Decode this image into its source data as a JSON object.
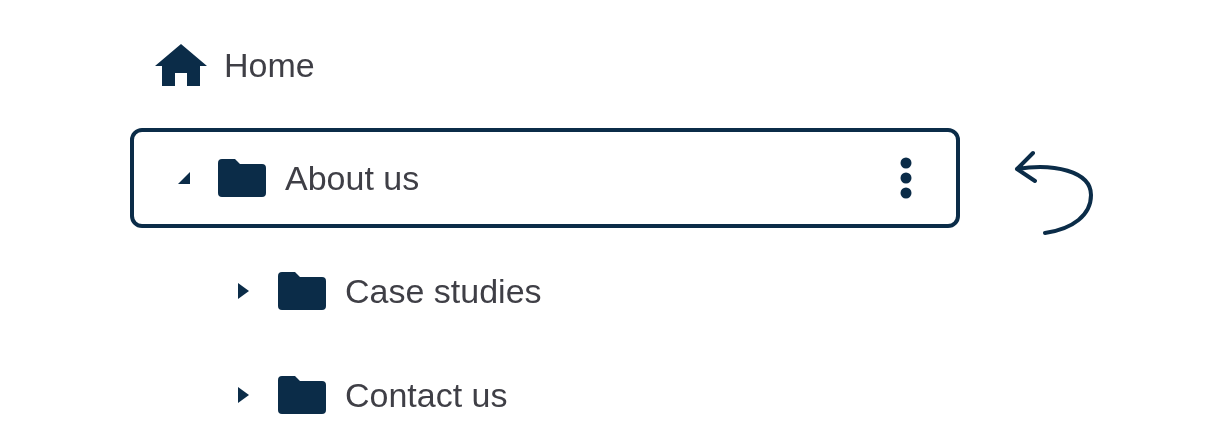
{
  "tree": [
    {
      "kind": "home",
      "label": "Home"
    },
    {
      "kind": "folder",
      "label": "About us",
      "selected": true,
      "expanded": true,
      "children": [
        {
          "kind": "folder",
          "label": "Case studies",
          "selected": false,
          "expanded": false
        },
        {
          "kind": "folder",
          "label": "Contact us",
          "selected": false,
          "expanded": false
        }
      ]
    }
  ]
}
